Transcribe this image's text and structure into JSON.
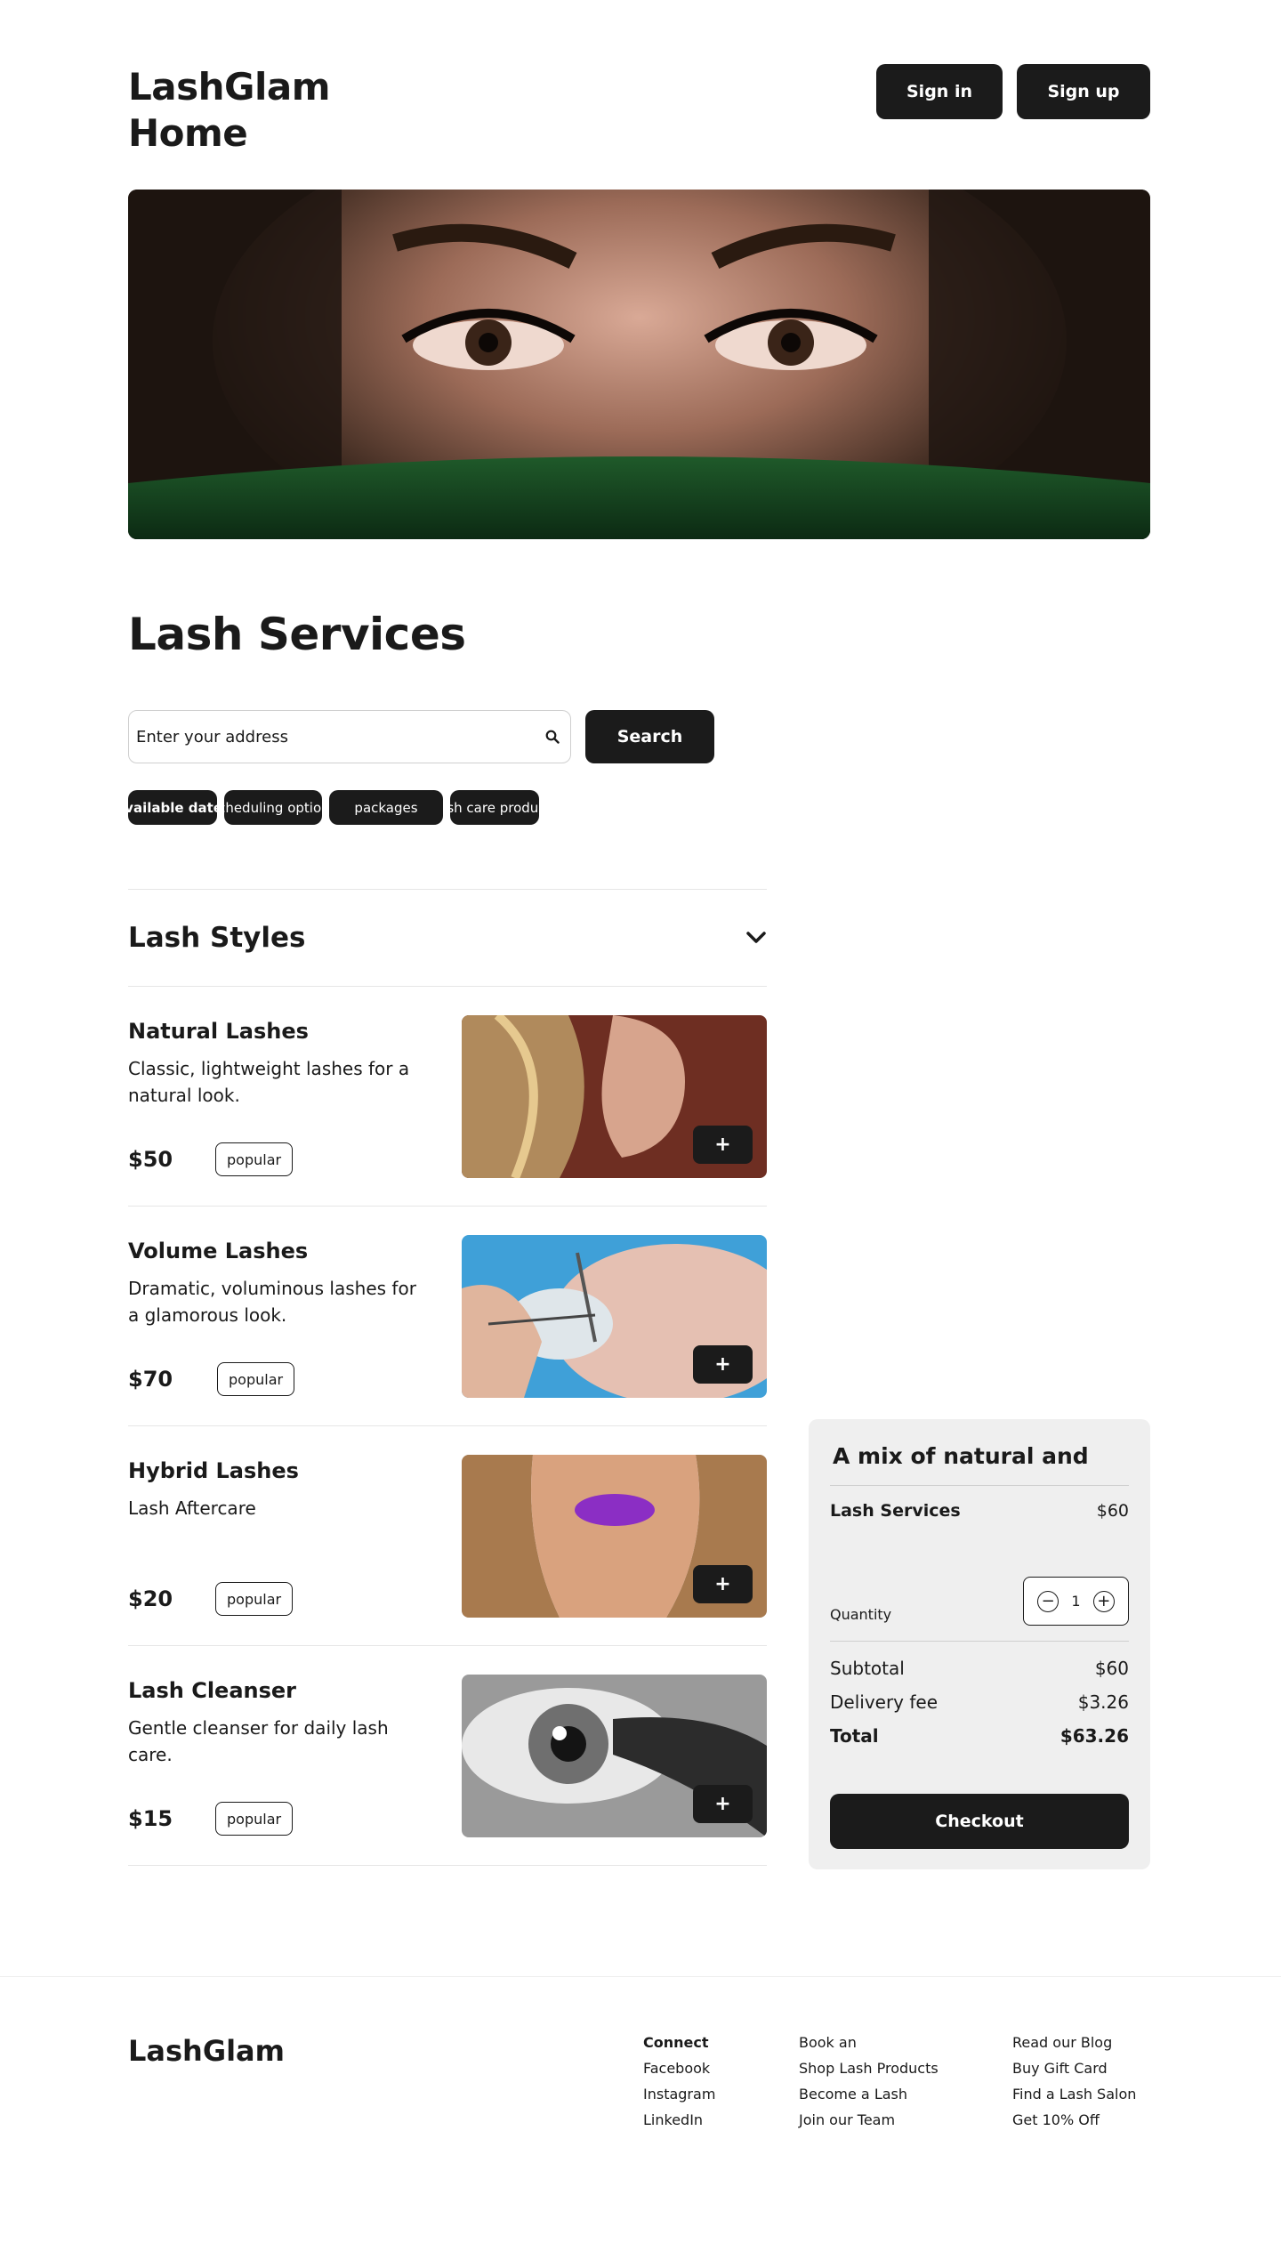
{
  "header": {
    "title": "LashGlam Home",
    "sign_in": "Sign in",
    "sign_up": "Sign up"
  },
  "services": {
    "title": "Lash Services",
    "search_placeholder": "Enter your address",
    "search_button": "Search",
    "search_icon": "magnifier-icon"
  },
  "chips": [
    {
      "label": "Available dates"
    },
    {
      "label": "Scheduling options"
    },
    {
      "label": "packages"
    },
    {
      "label": "Lash care products"
    }
  ],
  "lash_styles": {
    "title": "Lash Styles",
    "items": [
      {
        "name": "Natural Lashes",
        "description": "Classic, lightweight lashes for a natural look.",
        "price": "$50",
        "badge": "popular",
        "add_label": "+"
      },
      {
        "name": "Volume Lashes",
        "description": "Dramatic, voluminous lashes for a glamorous look.",
        "price": "$70",
        "badge": "popular",
        "add_label": "+"
      },
      {
        "name": "Hybrid Lashes",
        "description": "Lash Aftercare",
        "price": "$20",
        "badge": "popular",
        "add_label": "+"
      },
      {
        "name": "Lash Cleanser",
        "description": "Gentle cleanser for daily lash care.",
        "price": "$15",
        "badge": "popular",
        "add_label": "+"
      }
    ]
  },
  "cart": {
    "title": "A mix of natural and",
    "service_name": "Lash Services",
    "service_price": "$60",
    "quantity_label": "Quantity",
    "quantity": "1",
    "minus": "−",
    "plus": "+",
    "subtotal_label": "Subtotal",
    "subtotal": "$60",
    "delivery_label": "Delivery fee",
    "delivery": "$3.26",
    "total_label": "Total",
    "total": "$63.26",
    "checkout": "Checkout"
  },
  "footer": {
    "brand": "LashGlam",
    "col1": [
      "Connect",
      "Facebook",
      "Instagram",
      "LinkedIn"
    ],
    "col2": [
      "Book an",
      "Shop Lash Products",
      "Become a Lash",
      "Join our Team"
    ],
    "col3": [
      "Read our Blog",
      "Buy Gift Card",
      "Find a Lash Salon",
      "Get 10% Off"
    ]
  },
  "colors": {
    "primary": "#1b1b1b",
    "cart_bg": "#efefef",
    "background": "#ffffff"
  }
}
